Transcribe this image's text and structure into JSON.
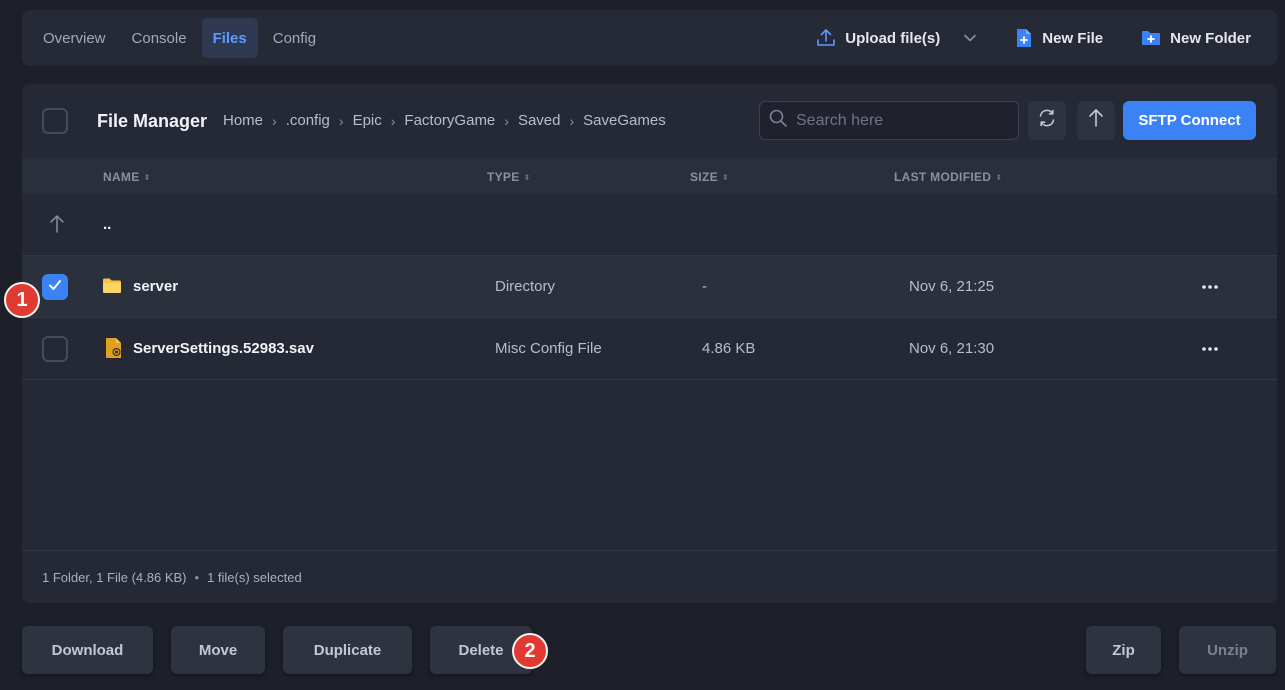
{
  "nav": {
    "tabs": [
      {
        "label": "Overview"
      },
      {
        "label": "Console"
      },
      {
        "label": "Files"
      },
      {
        "label": "Config"
      }
    ],
    "active_tab": "Files",
    "upload_label": "Upload file(s)",
    "new_file_label": "New File",
    "new_folder_label": "New Folder"
  },
  "file_manager": {
    "title": "File Manager",
    "breadcrumb": [
      "Home",
      ".config",
      "Epic",
      "FactoryGame",
      "Saved",
      "SaveGames"
    ],
    "search_placeholder": "Search here",
    "sftp_label": "SFTP Connect",
    "columns": {
      "name": "NAME",
      "type": "TYPE",
      "size": "SIZE",
      "modified": "LAST MODIFIED"
    },
    "parent_row_label": "..",
    "rows": [
      {
        "name": "server",
        "type": "Directory",
        "size": "-",
        "modified": "Nov 6, 21:25",
        "checked": true,
        "icon": "folder-icon"
      },
      {
        "name": "ServerSettings.52983.sav",
        "type": "Misc Config File",
        "size": "4.86 KB",
        "modified": "Nov 6, 21:30",
        "checked": false,
        "icon": "config-file-icon"
      }
    ],
    "summary": "1 Folder, 1 File (4.86 KB)",
    "selected": "1 file(s) selected"
  },
  "actions": {
    "download": "Download",
    "move": "Move",
    "duplicate": "Duplicate",
    "delete": "Delete",
    "zip": "Zip",
    "unzip": "Unzip"
  },
  "markers": {
    "m1": "1",
    "m2": "2"
  },
  "colors": {
    "accent": "#3b82f6",
    "marker": "#e13a32",
    "folder": "#f5c542",
    "file": "#e0a020"
  }
}
